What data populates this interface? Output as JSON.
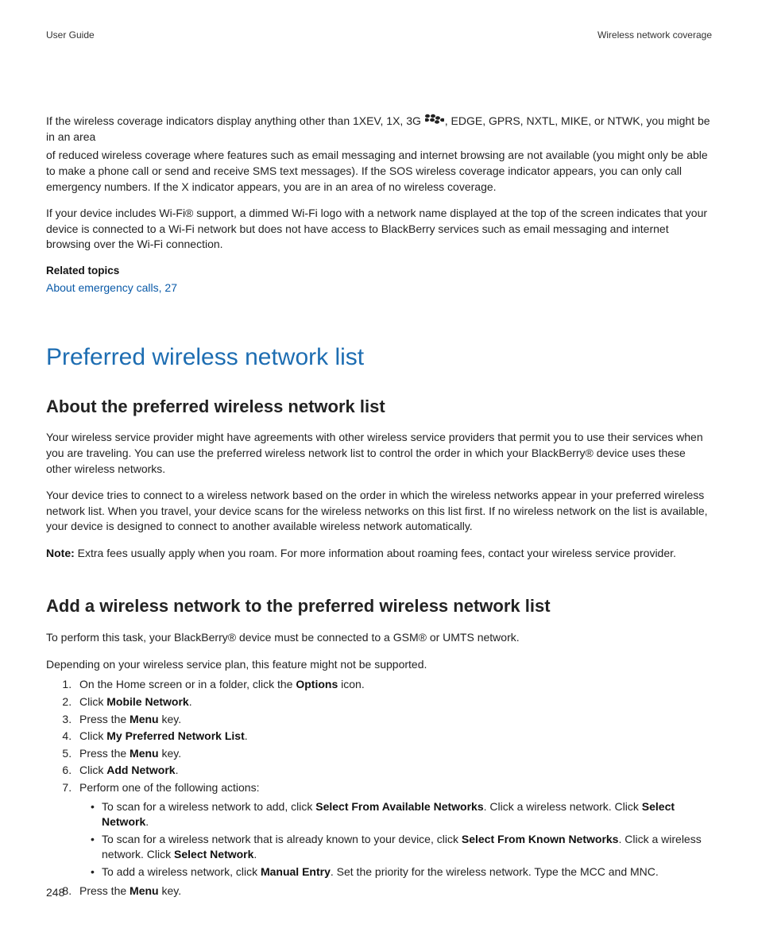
{
  "header": {
    "left": "User Guide",
    "right": "Wireless network coverage"
  },
  "intro": {
    "p1_before_icon": "If the wireless coverage indicators display anything other than 1XEV, 1X, 3G ",
    "p1_after_icon": ", EDGE, GPRS, NXTL, MIKE, or NTWK, you might be in an area",
    "p1_cont": "of reduced wireless coverage where features such as email messaging and internet browsing are not available (you might only be able to make a phone call or send and receive SMS text messages). If the SOS wireless coverage indicator appears, you can only call emergency numbers. If the X indicator appears, you are in an area of no wireless coverage.",
    "p2": "If your device includes Wi-Fi® support, a dimmed Wi-Fi logo with a network name displayed at the top of the screen indicates that your device is connected to a Wi-Fi network but does not have access to BlackBerry services such as email messaging and internet browsing over the Wi-Fi connection."
  },
  "related": {
    "heading": "Related topics",
    "link": "About emergency calls, 27"
  },
  "section": {
    "title": "Preferred wireless network list",
    "about": {
      "heading": "About the preferred wireless network list",
      "p1": "Your wireless service provider might have agreements with other wireless service providers that permit you to use their services when you are traveling. You can use the preferred wireless network list to control the order in which your BlackBerry® device uses these other wireless networks.",
      "p2": "Your device tries to connect to a wireless network based on the order in which the wireless networks appear in your preferred wireless network list. When you travel, your device scans for the wireless networks on this list first. If no wireless network on the list is available, your device is designed to connect to another available wireless network automatically.",
      "note_label": "Note:",
      "note_text": "  Extra fees usually apply when you roam. For more information about roaming fees, contact your wireless service provider."
    },
    "add": {
      "heading": "Add a wireless network to the preferred wireless network list",
      "p1": "To perform this task, your BlackBerry® device must be connected to a GSM® or UMTS network.",
      "p2": "Depending on your wireless service plan, this feature might not be supported.",
      "steps": {
        "s1_a": "On the Home screen or in a folder, click the ",
        "s1_b": "Options",
        "s1_c": " icon.",
        "s2_a": "Click ",
        "s2_b": "Mobile Network",
        "s2_c": ".",
        "s3_a": "Press the ",
        "s3_b": "Menu",
        "s3_c": " key.",
        "s4_a": "Click ",
        "s4_b": "My Preferred Network List",
        "s4_c": ".",
        "s5_a": "Press the ",
        "s5_b": "Menu",
        "s5_c": " key.",
        "s6_a": "Click ",
        "s6_b": "Add Network",
        "s6_c": ".",
        "s7_a": "Perform one of the following actions:",
        "s7_b1_a": "To scan for a wireless network to add, click ",
        "s7_b1_b": "Select From Available Networks",
        "s7_b1_c": ". Click a wireless network. Click ",
        "s7_b1_d": "Select Network",
        "s7_b1_e": ".",
        "s7_b2_a": "To scan for a wireless network that is already known to your device, click ",
        "s7_b2_b": "Select From Known Networks",
        "s7_b2_c": ". Click a wireless network. Click ",
        "s7_b2_d": "Select Network",
        "s7_b2_e": ".",
        "s7_b3_a": "To add a wireless network, click ",
        "s7_b3_b": "Manual Entry",
        "s7_b3_c": ". Set the priority for the wireless network. Type the MCC and MNC.",
        "s8_a": "Press the ",
        "s8_b": "Menu",
        "s8_c": " key."
      }
    }
  },
  "page_number": "248"
}
